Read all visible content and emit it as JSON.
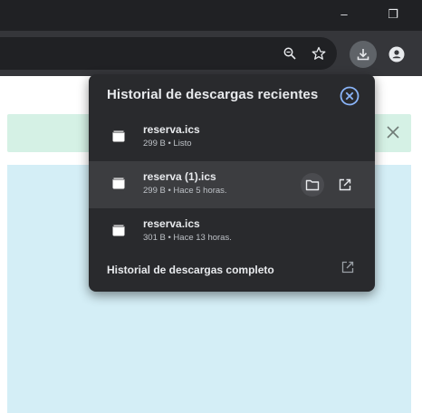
{
  "window": {
    "minimize_glyph": "–",
    "restore_glyph": "❐"
  },
  "toolbar": {
    "icons": [
      "zoom-icon",
      "bookmark-star-icon",
      "download-icon",
      "profile-icon"
    ]
  },
  "panel": {
    "title": "Historial de descargas recientes",
    "close_icon": "close-circle-icon",
    "downloads": [
      {
        "name": "reserva.ics",
        "meta": "299 B • Listo"
      },
      {
        "name": "reserva (1).ics",
        "meta": "299 B • Hace 5 horas."
      },
      {
        "name": "reserva.ics",
        "meta": "301 B • Hace 13 horas."
      }
    ],
    "footer_label": "Historial de descargas completo"
  },
  "colors": {
    "panel_bg": "#292a2d",
    "active_row": "#3c3d40",
    "download_button_bg": "#5f6368",
    "notice_bg": "#d5f1e5",
    "content_bg": "#d4eef6"
  }
}
